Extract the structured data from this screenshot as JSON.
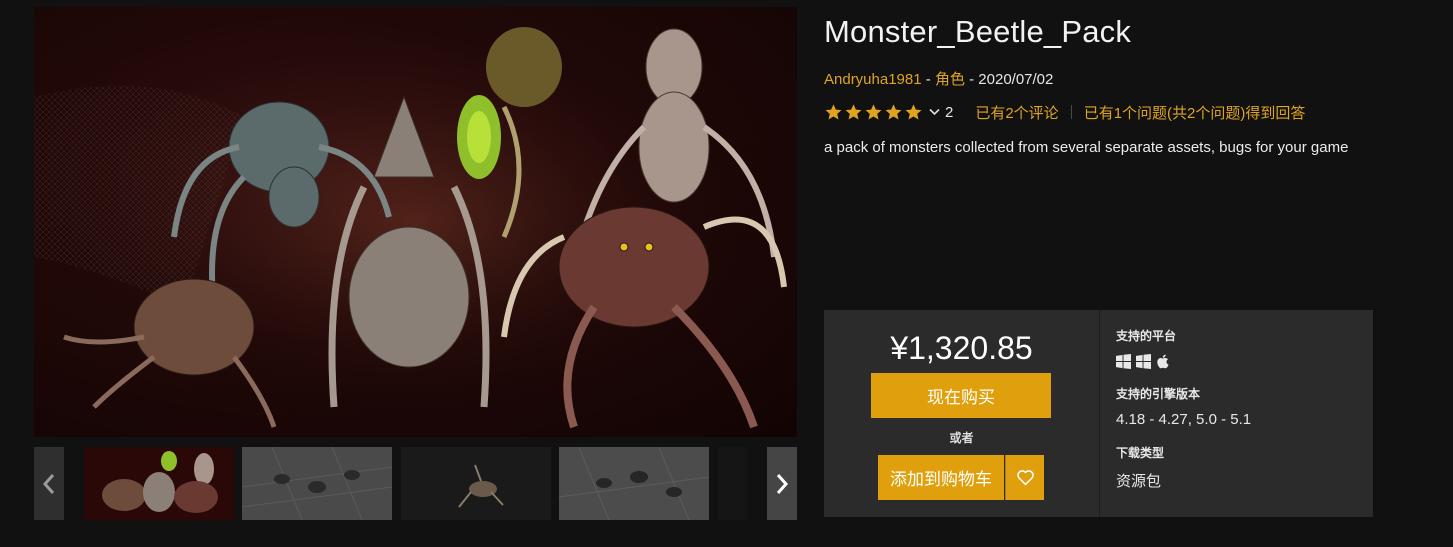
{
  "product": {
    "title": "Monster_Beetle_Pack",
    "author": "Andryuha1981",
    "meta_sep1": " - ",
    "category": "角色",
    "meta_sep2": " - ",
    "date": "2020/07/02",
    "rating_value": 5,
    "rating_count": "2",
    "reviews_link": "已有2个评论",
    "questions_link": "已有1个问题(共2个问题)得到回答",
    "description": "a pack of monsters collected from several separate assets, bugs for your game"
  },
  "gallery": {
    "thumbnail_count": 5,
    "active_index": 0
  },
  "purchase": {
    "price": "¥1,320.85",
    "buy_label": "现在购买",
    "or_label": "或者",
    "cart_label": "添加到购物车"
  },
  "specs": {
    "platforms_label": "支持的平台",
    "platform_icons": [
      "windows-icon",
      "windows-icon",
      "apple-icon"
    ],
    "engine_label": "支持的引擎版本",
    "engine_value": "4.18 - 4.27, 5.0 - 5.1",
    "download_label": "下载类型",
    "download_value": "资源包"
  },
  "colors": {
    "accent": "#e0a421",
    "button": "#e0a00d",
    "background": "#111111",
    "panel": "#2b2b2b"
  }
}
